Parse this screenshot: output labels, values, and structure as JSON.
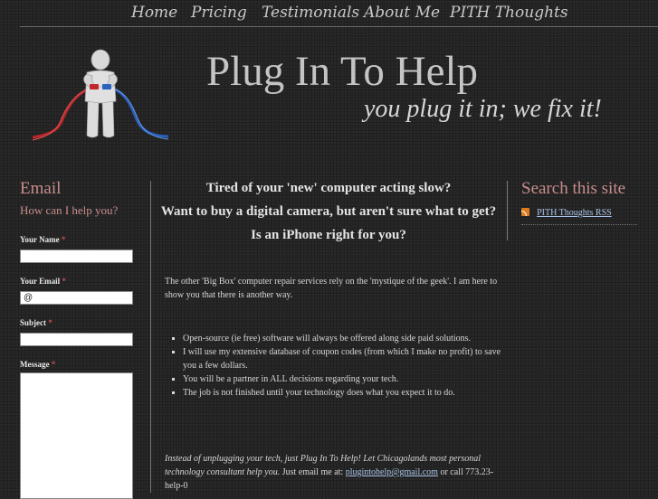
{
  "nav": {
    "items": [
      "Home",
      "Pricing",
      "Testimonials",
      "About Me",
      "PITH Thoughts"
    ]
  },
  "header": {
    "title": "Plug In To Help",
    "tagline": "you plug it in; we fix it!"
  },
  "left_sidebar": {
    "heading": "Email",
    "subheading": "How can I help you?",
    "form": {
      "name_label": "Your Name",
      "email_label": "Your Email",
      "email_value": "@",
      "subject_label": "Subject",
      "message_label": "Message",
      "required_mark": "*"
    }
  },
  "main": {
    "headlines": [
      "Tired of your 'new' computer acting slow?",
      "Want to buy a digital camera, but aren't sure what to get?",
      "Is an iPhone right for you?"
    ],
    "intro": "The other 'Big Box' computer repair services rely on the 'mystique of the geek'.  I am here to show you that there is another way.",
    "bullets": [
      "Open-source (ie free) software will always be offered along side paid solutions.",
      "I will use my extensive database of coupon codes (from which I make no profit) to save you a few dollars.",
      "You will be a partner in ALL decisions regarding your tech.",
      "The job is not finished until your technology does what you expect it to do."
    ],
    "closing": {
      "italic_text": "Instead of unplugging your tech, just Plug In To Help!  Let Chicagolands most personal technology consultant help you.",
      "plain_text": "  Just email me at: ",
      "email_link": "plugintohelp@gmail.com",
      "after_link": " or call 773.23-help-0"
    }
  },
  "right_sidebar": {
    "heading": "Search this site",
    "rss_label": "PITH Thoughts RSS"
  },
  "colors": {
    "background": "#262626",
    "accent_heading": "#c98d8d",
    "link": "#a9c4e8",
    "rss_orange": "#e07a1e"
  },
  "icons": {
    "logo": "figure-holding-plugs-icon",
    "rss": "rss-feed-icon"
  }
}
